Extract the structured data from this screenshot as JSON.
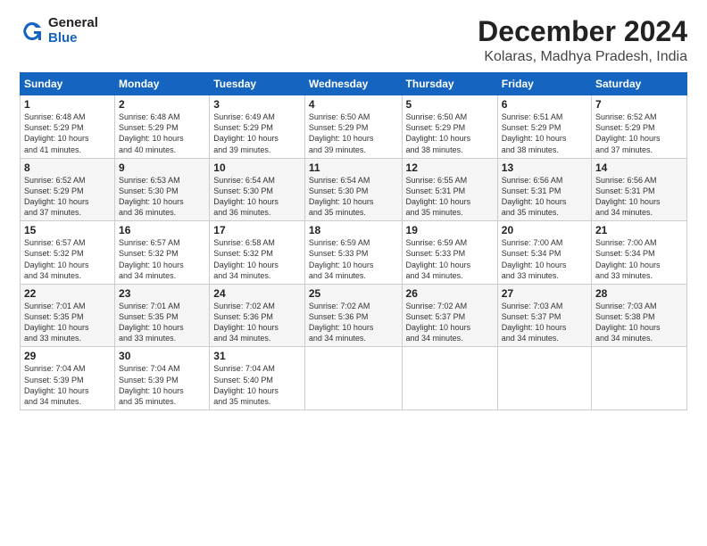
{
  "logo": {
    "general": "General",
    "blue": "Blue"
  },
  "title": "December 2024",
  "subtitle": "Kolaras, Madhya Pradesh, India",
  "headers": [
    "Sunday",
    "Monday",
    "Tuesday",
    "Wednesday",
    "Thursday",
    "Friday",
    "Saturday"
  ],
  "weeks": [
    [
      {
        "day": "1",
        "detail": "Sunrise: 6:48 AM\nSunset: 5:29 PM\nDaylight: 10 hours\nand 41 minutes."
      },
      {
        "day": "2",
        "detail": "Sunrise: 6:48 AM\nSunset: 5:29 PM\nDaylight: 10 hours\nand 40 minutes."
      },
      {
        "day": "3",
        "detail": "Sunrise: 6:49 AM\nSunset: 5:29 PM\nDaylight: 10 hours\nand 39 minutes."
      },
      {
        "day": "4",
        "detail": "Sunrise: 6:50 AM\nSunset: 5:29 PM\nDaylight: 10 hours\nand 39 minutes."
      },
      {
        "day": "5",
        "detail": "Sunrise: 6:50 AM\nSunset: 5:29 PM\nDaylight: 10 hours\nand 38 minutes."
      },
      {
        "day": "6",
        "detail": "Sunrise: 6:51 AM\nSunset: 5:29 PM\nDaylight: 10 hours\nand 38 minutes."
      },
      {
        "day": "7",
        "detail": "Sunrise: 6:52 AM\nSunset: 5:29 PM\nDaylight: 10 hours\nand 37 minutes."
      }
    ],
    [
      {
        "day": "8",
        "detail": "Sunrise: 6:52 AM\nSunset: 5:29 PM\nDaylight: 10 hours\nand 37 minutes."
      },
      {
        "day": "9",
        "detail": "Sunrise: 6:53 AM\nSunset: 5:30 PM\nDaylight: 10 hours\nand 36 minutes."
      },
      {
        "day": "10",
        "detail": "Sunrise: 6:54 AM\nSunset: 5:30 PM\nDaylight: 10 hours\nand 36 minutes."
      },
      {
        "day": "11",
        "detail": "Sunrise: 6:54 AM\nSunset: 5:30 PM\nDaylight: 10 hours\nand 35 minutes."
      },
      {
        "day": "12",
        "detail": "Sunrise: 6:55 AM\nSunset: 5:31 PM\nDaylight: 10 hours\nand 35 minutes."
      },
      {
        "day": "13",
        "detail": "Sunrise: 6:56 AM\nSunset: 5:31 PM\nDaylight: 10 hours\nand 35 minutes."
      },
      {
        "day": "14",
        "detail": "Sunrise: 6:56 AM\nSunset: 5:31 PM\nDaylight: 10 hours\nand 34 minutes."
      }
    ],
    [
      {
        "day": "15",
        "detail": "Sunrise: 6:57 AM\nSunset: 5:32 PM\nDaylight: 10 hours\nand 34 minutes."
      },
      {
        "day": "16",
        "detail": "Sunrise: 6:57 AM\nSunset: 5:32 PM\nDaylight: 10 hours\nand 34 minutes."
      },
      {
        "day": "17",
        "detail": "Sunrise: 6:58 AM\nSunset: 5:32 PM\nDaylight: 10 hours\nand 34 minutes."
      },
      {
        "day": "18",
        "detail": "Sunrise: 6:59 AM\nSunset: 5:33 PM\nDaylight: 10 hours\nand 34 minutes."
      },
      {
        "day": "19",
        "detail": "Sunrise: 6:59 AM\nSunset: 5:33 PM\nDaylight: 10 hours\nand 34 minutes."
      },
      {
        "day": "20",
        "detail": "Sunrise: 7:00 AM\nSunset: 5:34 PM\nDaylight: 10 hours\nand 33 minutes."
      },
      {
        "day": "21",
        "detail": "Sunrise: 7:00 AM\nSunset: 5:34 PM\nDaylight: 10 hours\nand 33 minutes."
      }
    ],
    [
      {
        "day": "22",
        "detail": "Sunrise: 7:01 AM\nSunset: 5:35 PM\nDaylight: 10 hours\nand 33 minutes."
      },
      {
        "day": "23",
        "detail": "Sunrise: 7:01 AM\nSunset: 5:35 PM\nDaylight: 10 hours\nand 33 minutes."
      },
      {
        "day": "24",
        "detail": "Sunrise: 7:02 AM\nSunset: 5:36 PM\nDaylight: 10 hours\nand 34 minutes."
      },
      {
        "day": "25",
        "detail": "Sunrise: 7:02 AM\nSunset: 5:36 PM\nDaylight: 10 hours\nand 34 minutes."
      },
      {
        "day": "26",
        "detail": "Sunrise: 7:02 AM\nSunset: 5:37 PM\nDaylight: 10 hours\nand 34 minutes."
      },
      {
        "day": "27",
        "detail": "Sunrise: 7:03 AM\nSunset: 5:37 PM\nDaylight: 10 hours\nand 34 minutes."
      },
      {
        "day": "28",
        "detail": "Sunrise: 7:03 AM\nSunset: 5:38 PM\nDaylight: 10 hours\nand 34 minutes."
      }
    ],
    [
      {
        "day": "29",
        "detail": "Sunrise: 7:04 AM\nSunset: 5:39 PM\nDaylight: 10 hours\nand 34 minutes."
      },
      {
        "day": "30",
        "detail": "Sunrise: 7:04 AM\nSunset: 5:39 PM\nDaylight: 10 hours\nand 35 minutes."
      },
      {
        "day": "31",
        "detail": "Sunrise: 7:04 AM\nSunset: 5:40 PM\nDaylight: 10 hours\nand 35 minutes."
      },
      {
        "day": "",
        "detail": ""
      },
      {
        "day": "",
        "detail": ""
      },
      {
        "day": "",
        "detail": ""
      },
      {
        "day": "",
        "detail": ""
      }
    ]
  ]
}
